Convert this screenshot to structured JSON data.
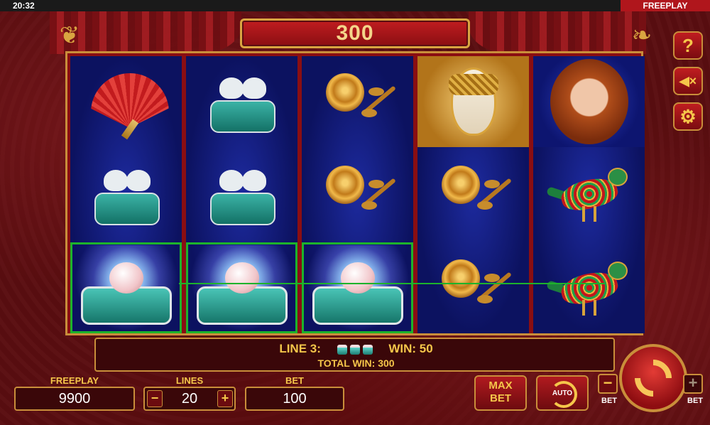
{
  "status_bar": {
    "time": "20:32",
    "mode": "FREEPLAY"
  },
  "top_display": {
    "win_amount": "300"
  },
  "reels": [
    [
      "fan",
      "dove-box",
      "music-box"
    ],
    [
      "dove-box",
      "dove-box",
      "music-box"
    ],
    [
      "rose",
      "rose",
      "music-box"
    ],
    [
      "mask",
      "rose",
      "rose"
    ],
    [
      "portrait",
      "bird",
      "bird"
    ]
  ],
  "winning_cells": [
    [
      0,
      2
    ],
    [
      1,
      2
    ],
    [
      2,
      2
    ]
  ],
  "info": {
    "line_label": "LINE 3:",
    "win_label": "WIN: 50",
    "total_label": "TOTAL WIN: 300",
    "symbol_count": 3
  },
  "controls": {
    "freeplay_label": "FREEPLAY",
    "freeplay_value": "9900",
    "lines_label": "LINES",
    "lines_value": "20",
    "lines_minus": "−",
    "lines_plus": "+",
    "bet_label": "BET",
    "bet_value": "100",
    "maxbet_line1": "MAX",
    "maxbet_line2": "BET",
    "auto_label": "AUTO",
    "bet_minus_label": "BET",
    "bet_plus_label": "BET",
    "bet_minus_glyph": "−",
    "bet_plus_glyph": "+"
  },
  "side_buttons": {
    "help_glyph": "?",
    "sound_glyph": "◀×",
    "settings_glyph": "⚙"
  },
  "colors": {
    "accent_gold": "#f5c64a",
    "win_green": "#1db32b",
    "frame": "#c98e3a"
  }
}
